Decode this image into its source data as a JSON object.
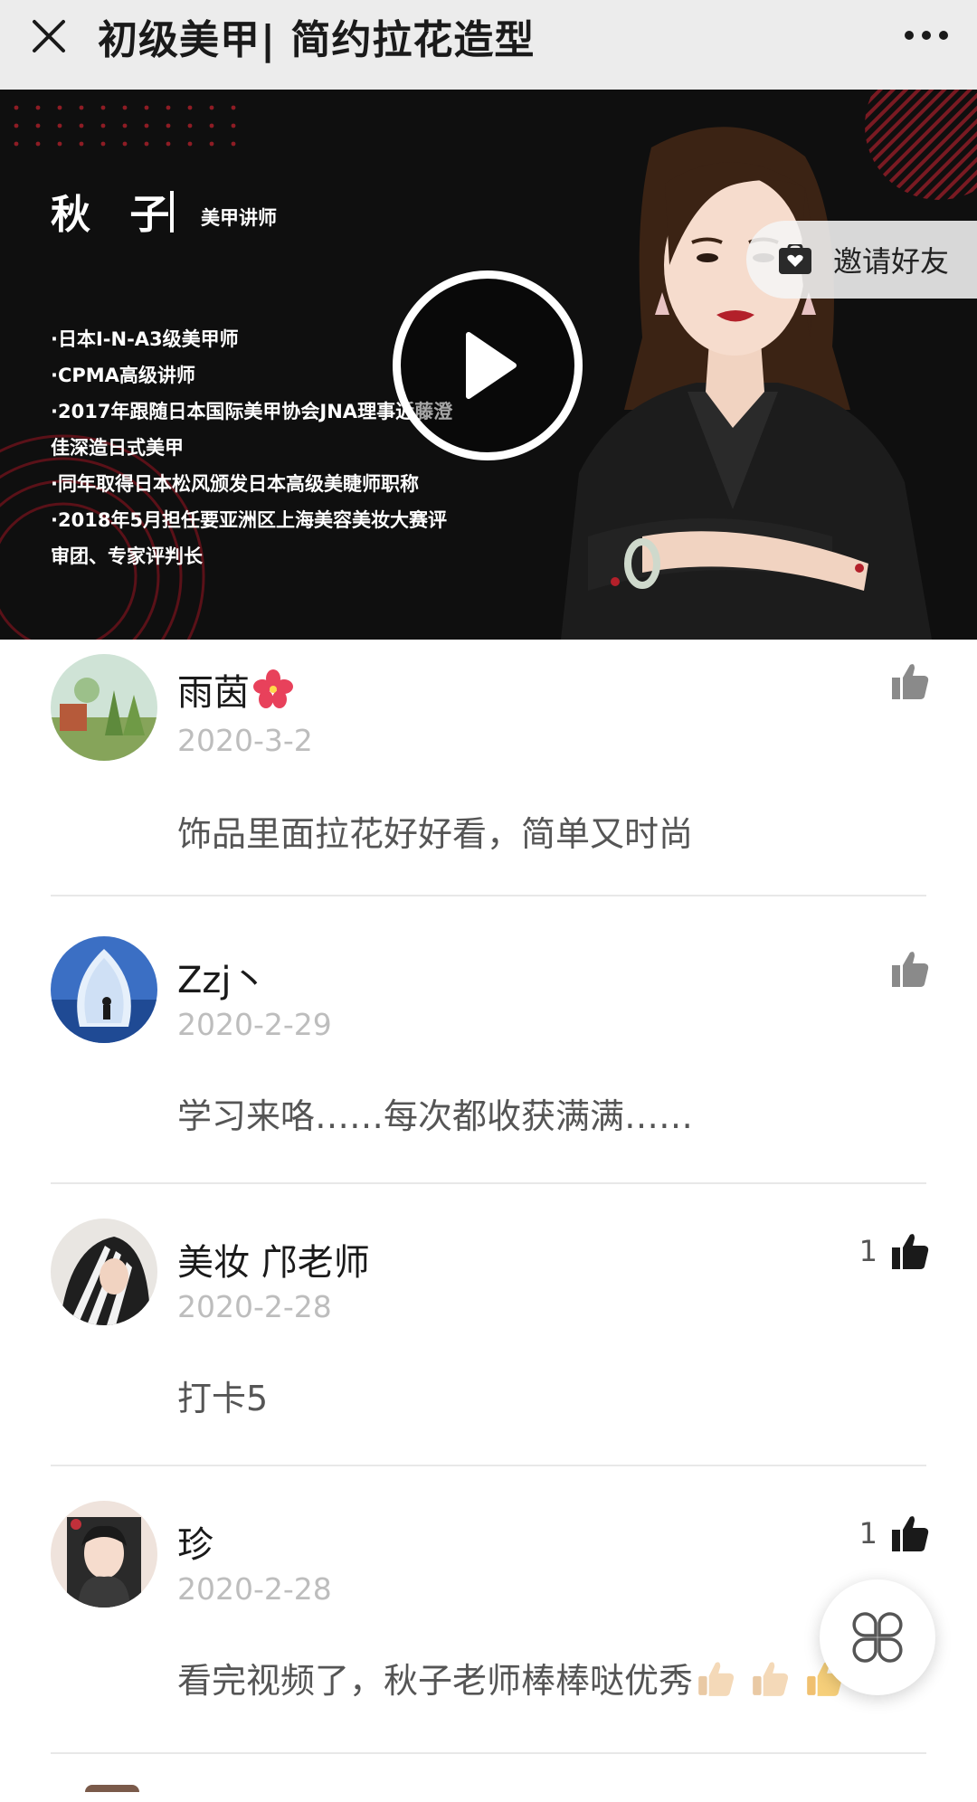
{
  "header": {
    "title": "初级美甲| 简约拉花造型",
    "close_icon": "close-icon",
    "more_icon": "more-horizontal-icon"
  },
  "video": {
    "teacher_name": "秋 子",
    "teacher_role": "美甲讲师",
    "bio_lines": [
      "·日本I-N-A3级美甲师",
      "·CPMA高级讲师",
      "·2017年跟随日本国际美甲协会JNA理事近藤澄",
      "佳深造日式美甲",
      "·同年取得日本松风颁发日本高级美睫师职称",
      "·2018年5月担任要亚洲区上海美容美妆大赛评",
      "审团、专家评判长"
    ],
    "play_icon": "play-icon",
    "invite": {
      "label": "邀请好友",
      "icon": "gift-bag-icon"
    }
  },
  "comments": [
    {
      "name": "雨茵",
      "name_emoji": "hibiscus-flower",
      "date": "2020-3-2",
      "text": "饰品里面拉花好好看，简单又时尚",
      "likes": "",
      "liked": false
    },
    {
      "name": "Zzj丶",
      "date": "2020-2-29",
      "text": "学习来咯……每次都收获满满……",
      "likes": "",
      "liked": false
    },
    {
      "name": "美妆 邝老师",
      "date": "2020-2-28",
      "text": "打卡5",
      "likes": "1",
      "liked": true
    },
    {
      "name": "珍",
      "date": "2020-2-28",
      "text": "看完视频了，秋子老师棒棒哒优秀",
      "text_emoji": "thumbs-up x3",
      "likes": "1",
      "liked": true
    }
  ],
  "float_menu_icon": "clover-menu-icon",
  "colors": {
    "topbar_bg": "#ececec",
    "video_bg": "#0f0f0f",
    "accent_red": "#b3202a",
    "like_inactive": "#8a8a8a",
    "like_active": "#1a1a1a",
    "date": "#bdbdbd"
  }
}
